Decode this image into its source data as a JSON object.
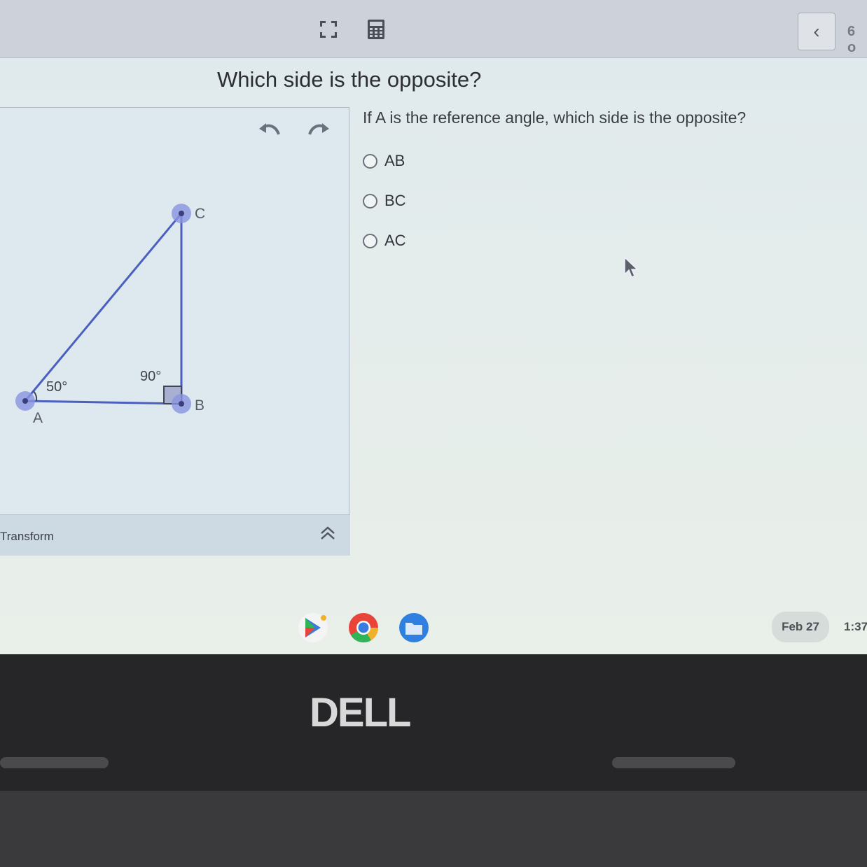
{
  "header": {
    "fullscreen_icon": "expand-icon",
    "calculator_icon": "calculator-icon",
    "back_icon": "chevron-left-icon",
    "pager_text": "6 o"
  },
  "question": {
    "title": "Which side is the opposite?",
    "prompt": "If A is the reference angle, which side is the opposite?",
    "options": [
      "AB",
      "BC",
      "AC"
    ]
  },
  "diagram": {
    "vertex_a": "A",
    "vertex_b": "B",
    "vertex_c": "C",
    "angle_a": "50°",
    "angle_b": "90°",
    "line_color": "#4b5fbf",
    "point_color": "#8a93e0"
  },
  "toolbar": {
    "undo_icon": "undo-icon",
    "redo_icon": "redo-icon",
    "transform_label": "Transform",
    "collapse_icon": "double-chevron-up-icon"
  },
  "taskbar": {
    "apps": [
      "play-store-icon",
      "chrome-icon",
      "files-icon"
    ],
    "date": "Feb 27",
    "time": "1:37"
  },
  "hardware": {
    "brand": "DELL"
  }
}
